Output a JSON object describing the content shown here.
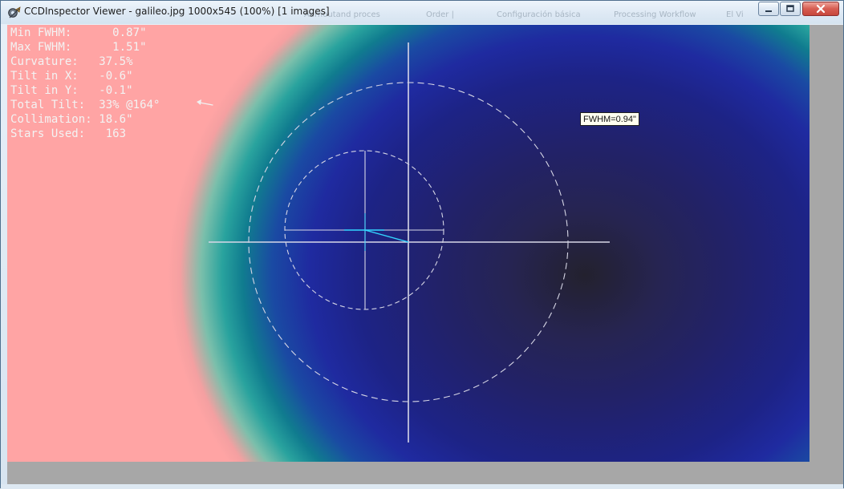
{
  "window": {
    "title": "CCDInspector Viewer - galileo.jpg 1000x545 (100%)  [1 images]",
    "background_taskbar_items": [
      "Aarnoutand proces",
      "Order |",
      "Configuración básica",
      "Processing Workflow",
      "El Vi"
    ]
  },
  "stats": {
    "lines": [
      "Min FWHM:      0.87\"",
      "Max FWHM:      1.51\"",
      "Curvature:   37.5%",
      "Tilt in X:   -0.6\"",
      "Tilt in Y:   -0.1\"",
      "Total Tilt:  33% @164°",
      "Collimation: 18.6\"",
      "Stars Used:   163"
    ]
  },
  "tooltip": {
    "fwhm_text": "FWHM=0.94\""
  },
  "colors": {
    "overlay_lines": "#d8d8e8",
    "tilt_vector": "#33d7ff",
    "stats_text": "#f3f3f3",
    "outer_background": "#a7a7a7"
  },
  "icons": {
    "app": "ccdinspector-app-icon",
    "minimize": "minimize-icon",
    "maximize": "maximize-icon",
    "close": "close-icon",
    "arrow": "left-arrow-icon"
  }
}
